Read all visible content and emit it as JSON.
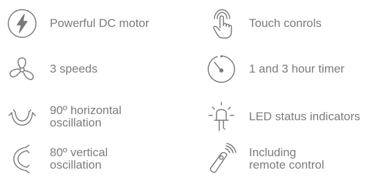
{
  "features": [
    {
      "icon": "lightning-bolt-icon",
      "lines": [
        "Powerful DC motor"
      ]
    },
    {
      "icon": "fan-icon",
      "lines": [
        "3 speeds"
      ]
    },
    {
      "icon": "horizontal-oscillation-icon",
      "lines": [
        "90º horizontal",
        "oscillation"
      ]
    },
    {
      "icon": "vertical-oscillation-icon",
      "lines": [
        "80º vertical",
        "oscillation"
      ]
    },
    {
      "icon": "touch-icon",
      "lines": [
        "Touch conrols"
      ]
    },
    {
      "icon": "timer-icon",
      "lines": [
        "1 and 3 hour timer"
      ]
    },
    {
      "icon": "led-icon",
      "lines": [
        "LED status indicators"
      ]
    },
    {
      "icon": "remote-control-icon",
      "lines": [
        "Including",
        "remote control"
      ]
    }
  ],
  "colors": {
    "icon_stroke": "#7a7a7a",
    "text": "#7b7b7b",
    "background": "#ffffff"
  }
}
